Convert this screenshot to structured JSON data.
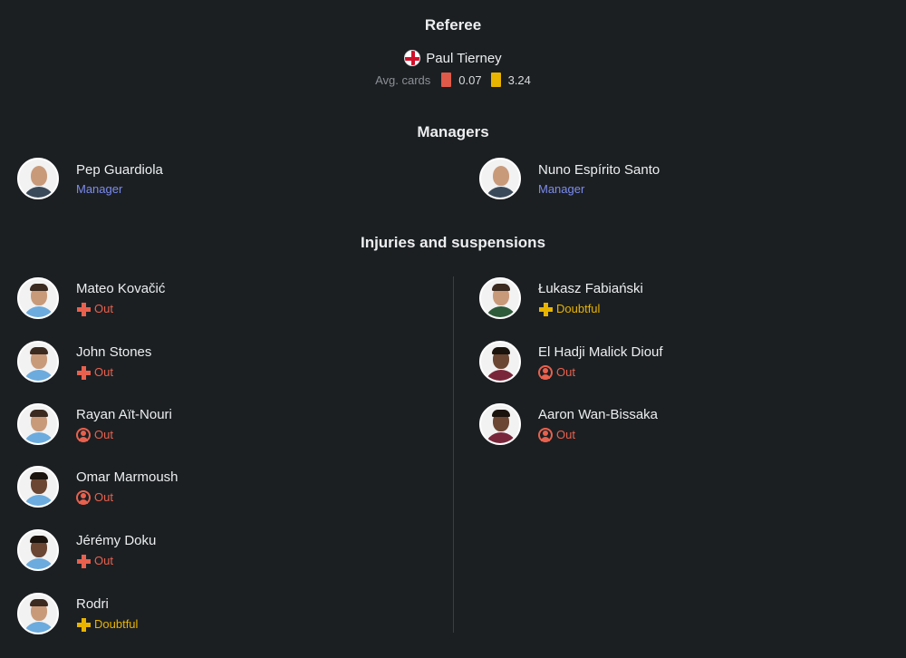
{
  "referee": {
    "title": "Referee",
    "name": "Paul Tierney",
    "avg_label": "Avg. cards",
    "red_avg": "0.07",
    "yellow_avg": "3.24"
  },
  "managers": {
    "title": "Managers",
    "home": {
      "name": "Pep Guardiola",
      "role": "Manager"
    },
    "away": {
      "name": "Nuno Espírito Santo",
      "role": "Manager"
    }
  },
  "injuries": {
    "title": "Injuries and suspensions",
    "home": [
      {
        "name": "Mateo Kovačić",
        "status": "Out",
        "type": "injury"
      },
      {
        "name": "John Stones",
        "status": "Out",
        "type": "injury"
      },
      {
        "name": "Rayan Aït-Nouri",
        "status": "Out",
        "type": "suspension"
      },
      {
        "name": "Omar Marmoush",
        "status": "Out",
        "type": "suspension"
      },
      {
        "name": "Jérémy Doku",
        "status": "Out",
        "type": "injury"
      },
      {
        "name": "Rodri",
        "status": "Doubtful",
        "type": "injury"
      }
    ],
    "away": [
      {
        "name": "Łukasz Fabiański",
        "status": "Doubtful",
        "type": "injury"
      },
      {
        "name": "El Hadji Malick Diouf",
        "status": "Out",
        "type": "suspension"
      },
      {
        "name": "Aaron Wan-Bissaka",
        "status": "Out",
        "type": "suspension"
      }
    ]
  },
  "colors": {
    "out": "#e8614e",
    "doubtful": "#e8b400",
    "manager_role": "#7b8cf0",
    "home_kit": "#6cabdd",
    "away_kit": "#7a263a"
  }
}
